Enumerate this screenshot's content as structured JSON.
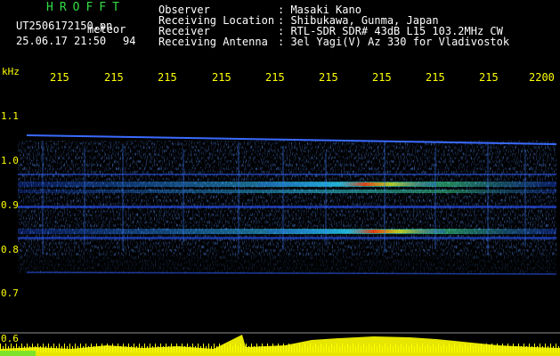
{
  "header": {
    "app_name": "HROFFT",
    "filename": "UT2506172150.pn",
    "detect_label": "meteor",
    "datetime": "25.06.17 21:50",
    "count": "94"
  },
  "info": [
    {
      "label": "Observer",
      "value": ": Masaki Kano"
    },
    {
      "label": "Receiving Location",
      "value": ": Shibukawa, Gunma, Japan"
    },
    {
      "label": "Receiver",
      "value": ": RTL-SDR SDR# 43dB L15 103.2MHz CW"
    },
    {
      "label": "Receiving Antenna",
      "value": ": 3el Yagi(V) Az 330 for Vladivostok"
    }
  ],
  "axis": {
    "unit": "kHz",
    "time_ticks": [
      "215",
      "215",
      "215",
      "215",
      "215",
      "215",
      "215",
      "215",
      "215",
      "2200"
    ],
    "freq_ticks": [
      "1.1",
      "1.0",
      "0.9",
      "0.8",
      "0.7",
      "0.6"
    ]
  },
  "colors": {
    "background": "#000000",
    "header_green": "#33dd44",
    "header_white": "#ffffff",
    "axis_yellow": "#ffff00",
    "signal_blue": "#1a4dff",
    "signal_hot": "#ff3300"
  }
}
